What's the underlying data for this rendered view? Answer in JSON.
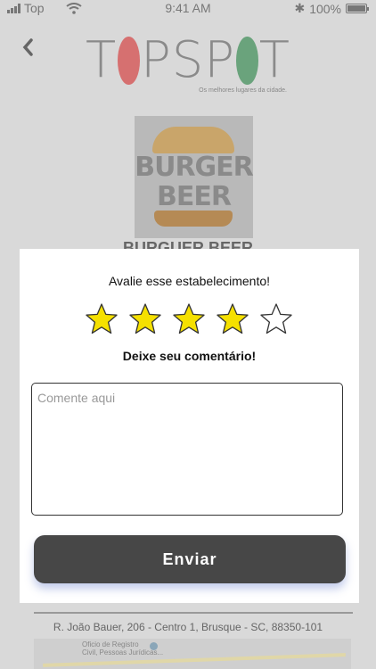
{
  "status_bar": {
    "carrier": "Top",
    "time": "9:41 AM",
    "battery": "100%"
  },
  "header": {
    "back_icon": "chevron-left-icon",
    "logo_text": "TOPSPOT",
    "tagline": "Os melhores lugares da cidade."
  },
  "restaurant": {
    "image_text_1": "BURGER",
    "image_text_2": "BEER",
    "name": "BURGUER BEER",
    "address": "R. João Bauer, 206 - Centro 1, Brusque - SC, 88350-101",
    "map_label": "Oficio de Registro\nCivil, Pessoas Jurídicas..."
  },
  "rating_modal": {
    "title": "Avalie esse estabelecimento!",
    "rating": 4,
    "max_rating": 5,
    "star_filled_color": "#f5e000",
    "subtitle": "Deixe seu comentário!",
    "comment": {
      "value": "",
      "placeholder": "Comente aqui"
    },
    "submit_label": "Enviar"
  }
}
